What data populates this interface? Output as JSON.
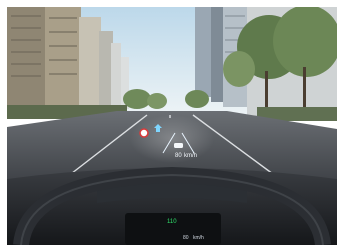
{
  "scene": {
    "hud": {
      "speed_text": "80",
      "speed_unit": "km/h",
      "sign_icon": "speed-limit-sign-icon",
      "nav_icon": "navigation-arrow-icon",
      "car_icon": "car-icon"
    },
    "cluster": {
      "readout": "110",
      "speed_text": "80",
      "speed_unit": "km/h"
    },
    "colors": {
      "sky": "#cfe3f0",
      "road": "#4b4f55",
      "dashboard": "#1f2226",
      "steering_wheel": "#2b2e33",
      "hud_accent": "#e9f4ff",
      "sign_red": "#d83a3a",
      "cluster_green": "#2ee06a"
    }
  }
}
